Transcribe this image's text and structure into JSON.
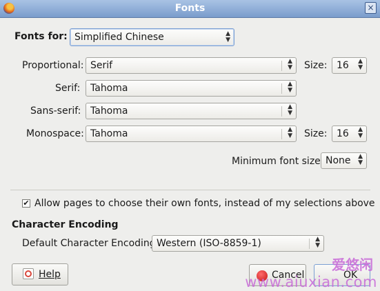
{
  "window": {
    "title": "Fonts",
    "close_glyph": "×"
  },
  "fonts_for": {
    "label": "Fonts for:",
    "value": "Simplified Chinese"
  },
  "proportional": {
    "label": "Proportional:",
    "value": "Serif",
    "size_label": "Size:",
    "size_value": "16"
  },
  "serif": {
    "label": "Serif:",
    "value": "Tahoma"
  },
  "sans_serif": {
    "label": "Sans-serif:",
    "value": "Tahoma"
  },
  "monospace": {
    "label": "Monospace:",
    "value": "Tahoma",
    "size_label": "Size:",
    "size_value": "16"
  },
  "min_font_size": {
    "label": "Minimum font size:",
    "value": "None"
  },
  "allow_pages": {
    "label": "Allow pages to choose their own fonts, instead of my selections above",
    "checked": true,
    "mark": "✔"
  },
  "encoding": {
    "heading": "Character Encoding",
    "label": "Default Character Encoding:",
    "value": "Western (ISO-8859-1)"
  },
  "buttons": {
    "help": "Help",
    "cancel": "Cancel",
    "ok": "OK"
  },
  "watermark": {
    "line1": "爱悠闲",
    "line2": "www.aiuxian.com"
  },
  "colors": {
    "titlebar": "#7a9ccc",
    "background": "#eeeeec",
    "watermark": "#c86ad8"
  }
}
